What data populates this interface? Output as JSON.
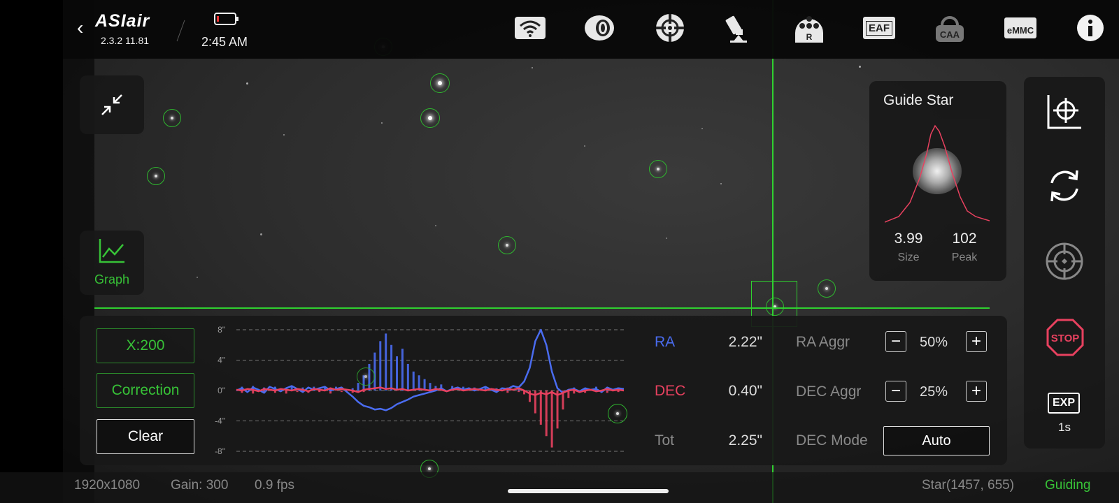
{
  "app": {
    "name": "ASIair",
    "version": "2.3.2 11.81",
    "time": "2:45 AM"
  },
  "toolbar": {
    "icons": [
      "wifi-icon",
      "camera-icon",
      "guide-icon",
      "telescope-icon",
      "filter-wheel-icon",
      "eaf-icon",
      "caa-icon",
      "emmc-icon",
      "info-icon"
    ],
    "filter_label": "R",
    "eaf_label": "EAF",
    "caa_label": "CAA",
    "emmc_label": "eMMC"
  },
  "left": {
    "graph_label": "Graph"
  },
  "guide_star": {
    "title": "Guide Star",
    "size_value": "3.99",
    "size_label": "Size",
    "peak_value": "102",
    "peak_label": "Peak"
  },
  "right_panel": {
    "exp_label": "EXP",
    "exp_value": "1s",
    "stop_label": "STOP"
  },
  "guide_panel": {
    "x_button": "X:200",
    "correction_button": "Correction",
    "clear_button": "Clear",
    "ra_label": "RA",
    "ra_value": "2.22\"",
    "dec_label": "DEC",
    "dec_value": "0.40\"",
    "tot_label": "Tot",
    "tot_value": "2.25\"",
    "ra_aggr_label": "RA Aggr",
    "ra_aggr_value": "50%",
    "dec_aggr_label": "DEC Aggr",
    "dec_aggr_value": "25%",
    "dec_mode_label": "DEC Mode",
    "dec_mode_value": "Auto",
    "minus": "−",
    "plus": "+"
  },
  "status": {
    "resolution": "1920x1080",
    "gain": "Gain: 300",
    "fps": "0.9 fps",
    "star": "Star(1457, 655)",
    "state": "Guiding"
  },
  "colors": {
    "ra": "#4a6cf0",
    "dec": "#e8415f",
    "accent": "#37c237"
  },
  "chart_data": {
    "type": "line",
    "yticks": [
      "8\"",
      "4\"",
      "0\"",
      "-4\"",
      "-8\""
    ],
    "ylim": [
      -8,
      8
    ],
    "series": [
      {
        "name": "RA",
        "values": [
          0,
          0.3,
          -0.2,
          0.4,
          0.1,
          -0.3,
          0.5,
          0.2,
          -0.1,
          0.3,
          0.6,
          0.2,
          -0.2,
          0.4,
          0.1,
          0.3,
          0.5,
          0,
          0.2,
          0.4,
          -0.2,
          -0.8,
          -1.5,
          -2,
          -2.2,
          -2.5,
          -2.4,
          -2.6,
          -2.3,
          -1.8,
          -1.5,
          -1.2,
          -0.8,
          -0.6,
          -0.4,
          -0.2,
          0,
          0.3,
          -0.1,
          0.2,
          0.4,
          0.1,
          0.3,
          0,
          0.2,
          0.5,
          0.1,
          -0.2,
          0.3,
          0.2,
          0.6,
          0.4,
          1.2,
          3,
          6.5,
          8,
          6,
          2.5,
          0.3,
          -0.3,
          0.1,
          0.2,
          -0.1,
          0.3,
          0.1,
          0.2,
          -0.2,
          0.4,
          0.1,
          0.3,
          0.2
        ]
      },
      {
        "name": "DEC",
        "values": [
          0.1,
          0,
          0.2,
          0.1,
          -0.1,
          0.2,
          0.1,
          0,
          0.2,
          0.1,
          0,
          0.2,
          0.1,
          -0.1,
          0.2,
          0.1,
          0,
          0.3,
          0.1,
          0.2,
          0.1,
          0,
          -0.2,
          0.1,
          0.2,
          0.3,
          0.4,
          0.2,
          0.3,
          0.1,
          0.2,
          0,
          0.1,
          0.2,
          0.1,
          0,
          0.2,
          0.1,
          -0.1,
          0.1,
          0.2,
          0,
          0.1,
          0.2,
          0.1,
          0,
          0.2,
          0.1,
          0,
          0.2,
          0.1,
          0.3,
          0,
          -0.4,
          -0.6,
          -0.3,
          -0.5,
          -0.2,
          -0.6,
          -0.3,
          0,
          0.1,
          -0.2,
          0,
          0.1,
          -0.1,
          0,
          0.2,
          0,
          0.1,
          0
        ]
      },
      {
        "name": "RA correction",
        "values": [
          0,
          0.5,
          0,
          0.6,
          0,
          0.4,
          0,
          0.5,
          0,
          0.3,
          0.6,
          0,
          0.4,
          0,
          0.5,
          0,
          0.4,
          0,
          0.5,
          0,
          0,
          0.3,
          1,
          2,
          3.5,
          5,
          6.5,
          7.5,
          6,
          4.5,
          5.5,
          3.5,
          2.5,
          2,
          1.5,
          1,
          0.6,
          0.8,
          0,
          0.6,
          0,
          0.5,
          0,
          0.4,
          0,
          0.5,
          0,
          0.3,
          0,
          0.4,
          0,
          0.3,
          0,
          0,
          0,
          0,
          0,
          0,
          0,
          0,
          0,
          0.4,
          0,
          0.3,
          0,
          0.5,
          0,
          0.3,
          0,
          0.4,
          0
        ]
      },
      {
        "name": "DEC correction",
        "values": [
          0,
          -0.3,
          0,
          -0.4,
          0,
          -0.2,
          0,
          -0.3,
          0,
          -0.4,
          0,
          -0.2,
          0,
          -0.3,
          0,
          -0.2,
          0,
          -0.4,
          0,
          -0.2,
          0,
          -0.3,
          0,
          -0.2,
          0,
          0,
          0,
          0,
          0,
          0,
          0,
          0,
          0,
          0,
          0,
          0,
          0,
          0,
          0,
          0,
          0,
          0,
          0,
          0,
          0,
          0,
          0,
          -0.2,
          0,
          -0.3,
          0,
          -0.2,
          -0.5,
          -1.5,
          -3,
          -4.5,
          -6,
          -7.5,
          -5,
          -2.5,
          -1,
          -0.4,
          0,
          -0.3,
          0,
          -0.2,
          0,
          -0.3,
          0,
          -0.2,
          0
        ]
      }
    ]
  }
}
